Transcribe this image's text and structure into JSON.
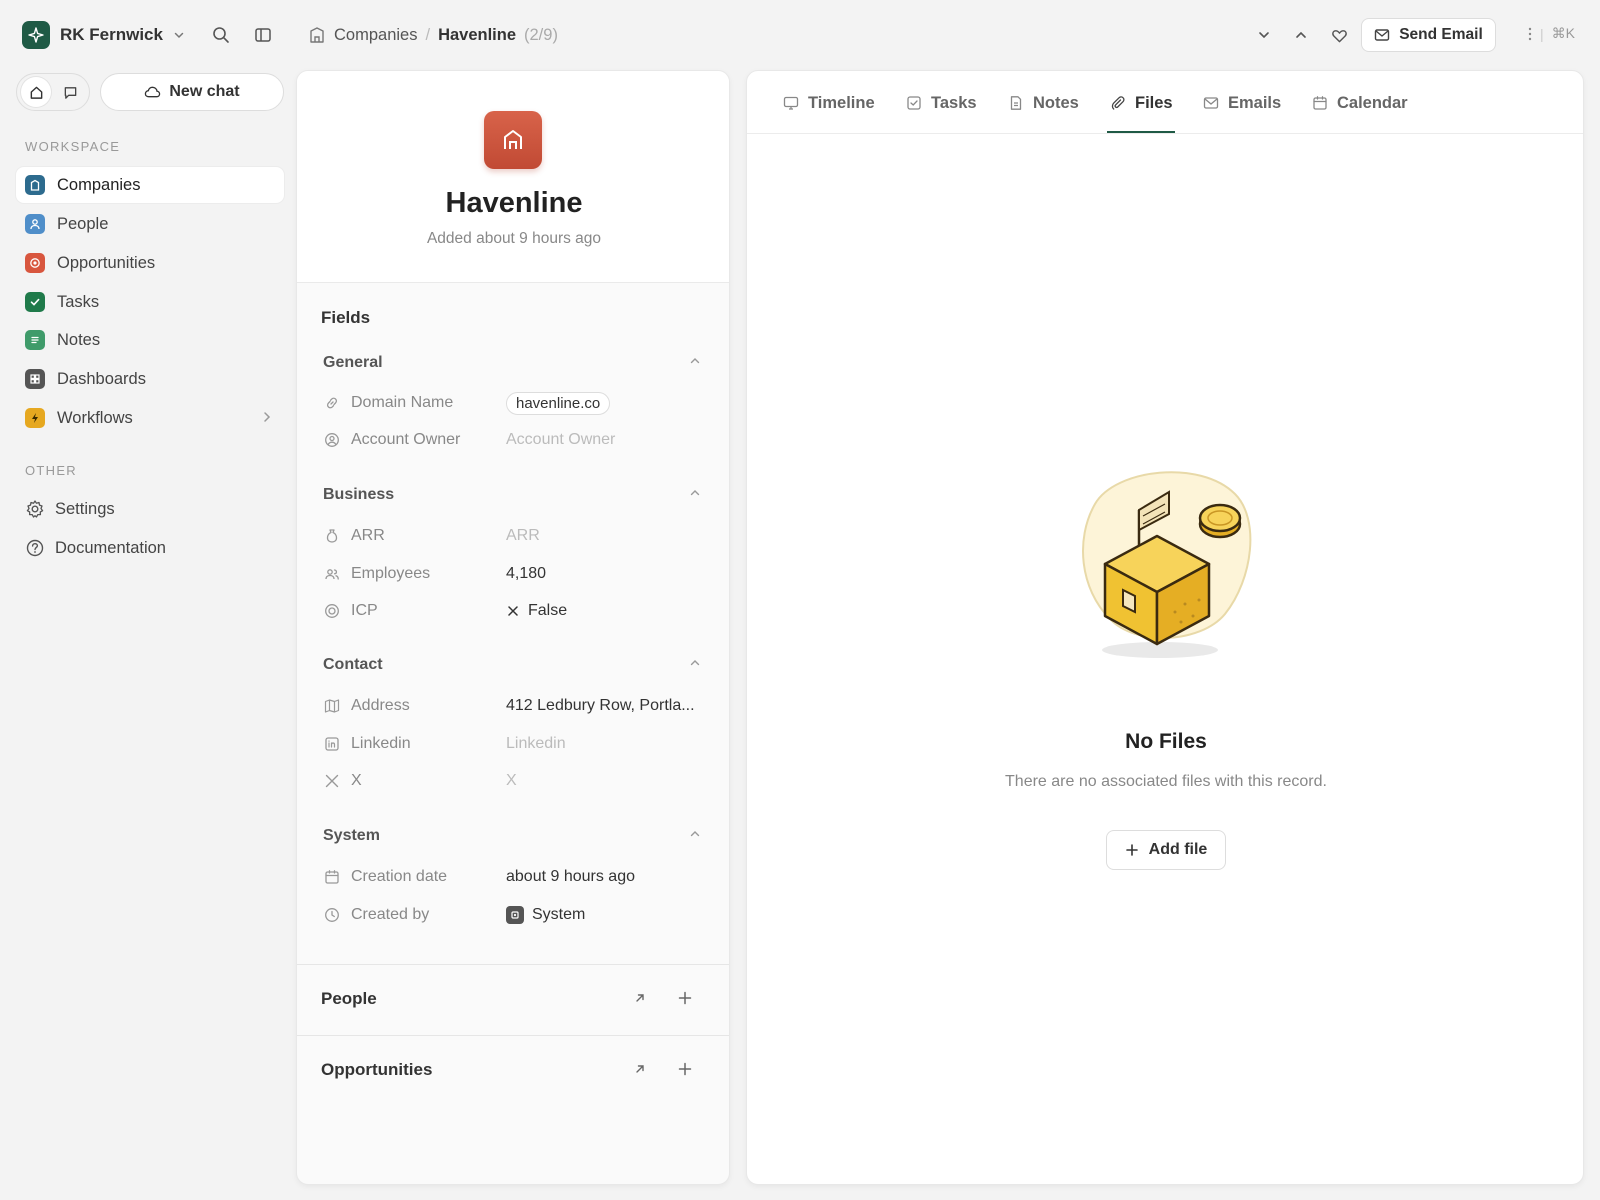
{
  "workspace": {
    "name": "RK Fernwick"
  },
  "breadcrumb": {
    "parent": "Companies",
    "separator": "/",
    "current": "Havenline",
    "position": "(2/9)"
  },
  "header": {
    "send_email_label": "Send Email",
    "shortcut": "⌘K"
  },
  "sidebar": {
    "new_chat_label": "New chat",
    "workspace_section": "WORKSPACE",
    "items": [
      {
        "label": "Companies",
        "color": "#2d6b8e"
      },
      {
        "label": "People",
        "color": "#4f8ec9"
      },
      {
        "label": "Opportunities",
        "color": "#d8563e"
      },
      {
        "label": "Tasks",
        "color": "#1f7a4a"
      },
      {
        "label": "Notes",
        "color": "#3f9b6a"
      },
      {
        "label": "Dashboards",
        "color": "#555555"
      },
      {
        "label": "Workflows",
        "color": "#e6a820"
      }
    ],
    "other_section": "OTHER",
    "other_items": [
      {
        "label": "Settings"
      },
      {
        "label": "Documentation"
      }
    ]
  },
  "record": {
    "name": "Havenline",
    "subtitle": "Added about 9 hours ago",
    "fields_title": "Fields",
    "groups": {
      "general": {
        "title": "General",
        "domain_label": "Domain Name",
        "domain_value": "havenline.co",
        "owner_label": "Account Owner",
        "owner_value": "Account Owner"
      },
      "business": {
        "title": "Business",
        "arr_label": "ARR",
        "arr_value": "ARR",
        "employees_label": "Employees",
        "employees_value": "4,180",
        "icp_label": "ICP",
        "icp_value": "False"
      },
      "contact": {
        "title": "Contact",
        "address_label": "Address",
        "address_value": "412 Ledbury Row, Portla...",
        "linkedin_label": "Linkedin",
        "linkedin_value": "Linkedin",
        "x_label": "X",
        "x_value": "X"
      },
      "system": {
        "title": "System",
        "creation_label": "Creation date",
        "creation_value": "about 9 hours ago",
        "created_by_label": "Created by",
        "created_by_value": "System"
      }
    },
    "relations": [
      {
        "title": "People"
      },
      {
        "title": "Opportunities"
      }
    ]
  },
  "tabs": [
    {
      "label": "Timeline"
    },
    {
      "label": "Tasks"
    },
    {
      "label": "Notes"
    },
    {
      "label": "Files",
      "active": true
    },
    {
      "label": "Emails"
    },
    {
      "label": "Calendar"
    }
  ],
  "files_empty": {
    "title": "No Files",
    "subtitle": "There are no associated files with this record.",
    "add_label": "Add file"
  },
  "colors": {
    "accent": "#1f5a45",
    "record_logo": "#c94f38"
  }
}
